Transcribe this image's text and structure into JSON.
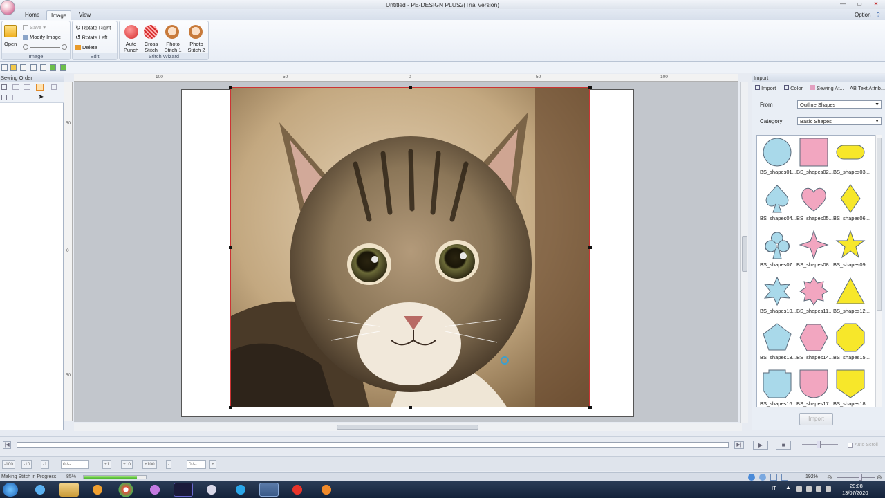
{
  "window": {
    "title": "Untitled - PE-DESIGN PLUS2(Trial version)",
    "minimize": "—",
    "restore": "▭",
    "close": "✕",
    "help": "?"
  },
  "tabs": {
    "home": "Home",
    "image": "Image",
    "view": "View",
    "option": "Option"
  },
  "ribbon": {
    "image_group": {
      "label": "Image",
      "open": "Open",
      "save": "Save",
      "modify_image": "Modify Image"
    },
    "edit_group": {
      "label": "Edit",
      "rotate_right": "Rotate Right",
      "rotate_left": "Rotate Left",
      "delete": "Delete"
    },
    "stitch_wizard_group": {
      "label": "Stitch Wizard",
      "auto_punch": [
        "Auto",
        "Punch"
      ],
      "cross_stitch": [
        "Cross",
        "Stitch"
      ],
      "photo_stitch_1": [
        "Photo",
        "Stitch 1"
      ],
      "photo_stitch_2": [
        "Photo",
        "Stitch 2"
      ]
    }
  },
  "left_panel": {
    "title": "Sewing Order"
  },
  "rulers": {
    "h": [
      "100",
      "50",
      "0",
      "50",
      "100"
    ],
    "v": [
      "50",
      "0",
      "50"
    ]
  },
  "right_panel": {
    "title": "Import",
    "tabs": [
      "Import",
      "Color",
      "Sewing At...",
      "AB Text Attrib..."
    ],
    "from_label": "From",
    "from_value": "Outline Shapes",
    "category_label": "Category",
    "category_value": "Basic Shapes",
    "import_button": "Import",
    "shapes": [
      {
        "label": "BS_shapes01...",
        "shape": "circle",
        "color": "#a9d9ea"
      },
      {
        "label": "BS_shapes02...",
        "shape": "square",
        "color": "#f2a6c0"
      },
      {
        "label": "BS_shapes03...",
        "shape": "pill",
        "color": "#f7e72a"
      },
      {
        "label": "BS_shapes04...",
        "shape": "spade",
        "color": "#a9d9ea"
      },
      {
        "label": "BS_shapes05...",
        "shape": "heart",
        "color": "#f2a6c0"
      },
      {
        "label": "BS_shapes06...",
        "shape": "diamond",
        "color": "#f7e72a"
      },
      {
        "label": "BS_shapes07...",
        "shape": "club",
        "color": "#a9d9ea"
      },
      {
        "label": "BS_shapes08...",
        "shape": "star4",
        "color": "#f2a6c0"
      },
      {
        "label": "BS_shapes09...",
        "shape": "star5",
        "color": "#f7e72a"
      },
      {
        "label": "BS_shapes10...",
        "shape": "star6",
        "color": "#a9d9ea"
      },
      {
        "label": "BS_shapes11...",
        "shape": "star8",
        "color": "#f2a6c0"
      },
      {
        "label": "BS_shapes12...",
        "shape": "triangle",
        "color": "#f7e72a"
      },
      {
        "label": "BS_shapes13...",
        "shape": "pentagon",
        "color": "#a9d9ea"
      },
      {
        "label": "BS_shapes14...",
        "shape": "hexagon",
        "color": "#f2a6c0"
      },
      {
        "label": "BS_shapes15...",
        "shape": "octagon",
        "color": "#f7e72a"
      },
      {
        "label": "BS_shapes16...",
        "shape": "badge",
        "color": "#a9d9ea"
      },
      {
        "label": "BS_shapes17...",
        "shape": "shield",
        "color": "#f2a6c0"
      },
      {
        "label": "BS_shapes18...",
        "shape": "shield2",
        "color": "#f7e72a"
      }
    ]
  },
  "playbar": {
    "auto_scroll": "Auto Scroll"
  },
  "navbar": {
    "buttons": [
      "-100",
      "-10",
      "-1",
      "0 /--",
      "+1",
      "+10",
      "+100",
      "-",
      "0 /--",
      "+"
    ]
  },
  "status": {
    "text": "Making Stitch in Progress.",
    "percent_text": "85%",
    "progress": 0.85,
    "zoom": "192%"
  },
  "taskbar": {
    "lang": "IT",
    "time": "20:08",
    "date": "13/07/2020"
  }
}
